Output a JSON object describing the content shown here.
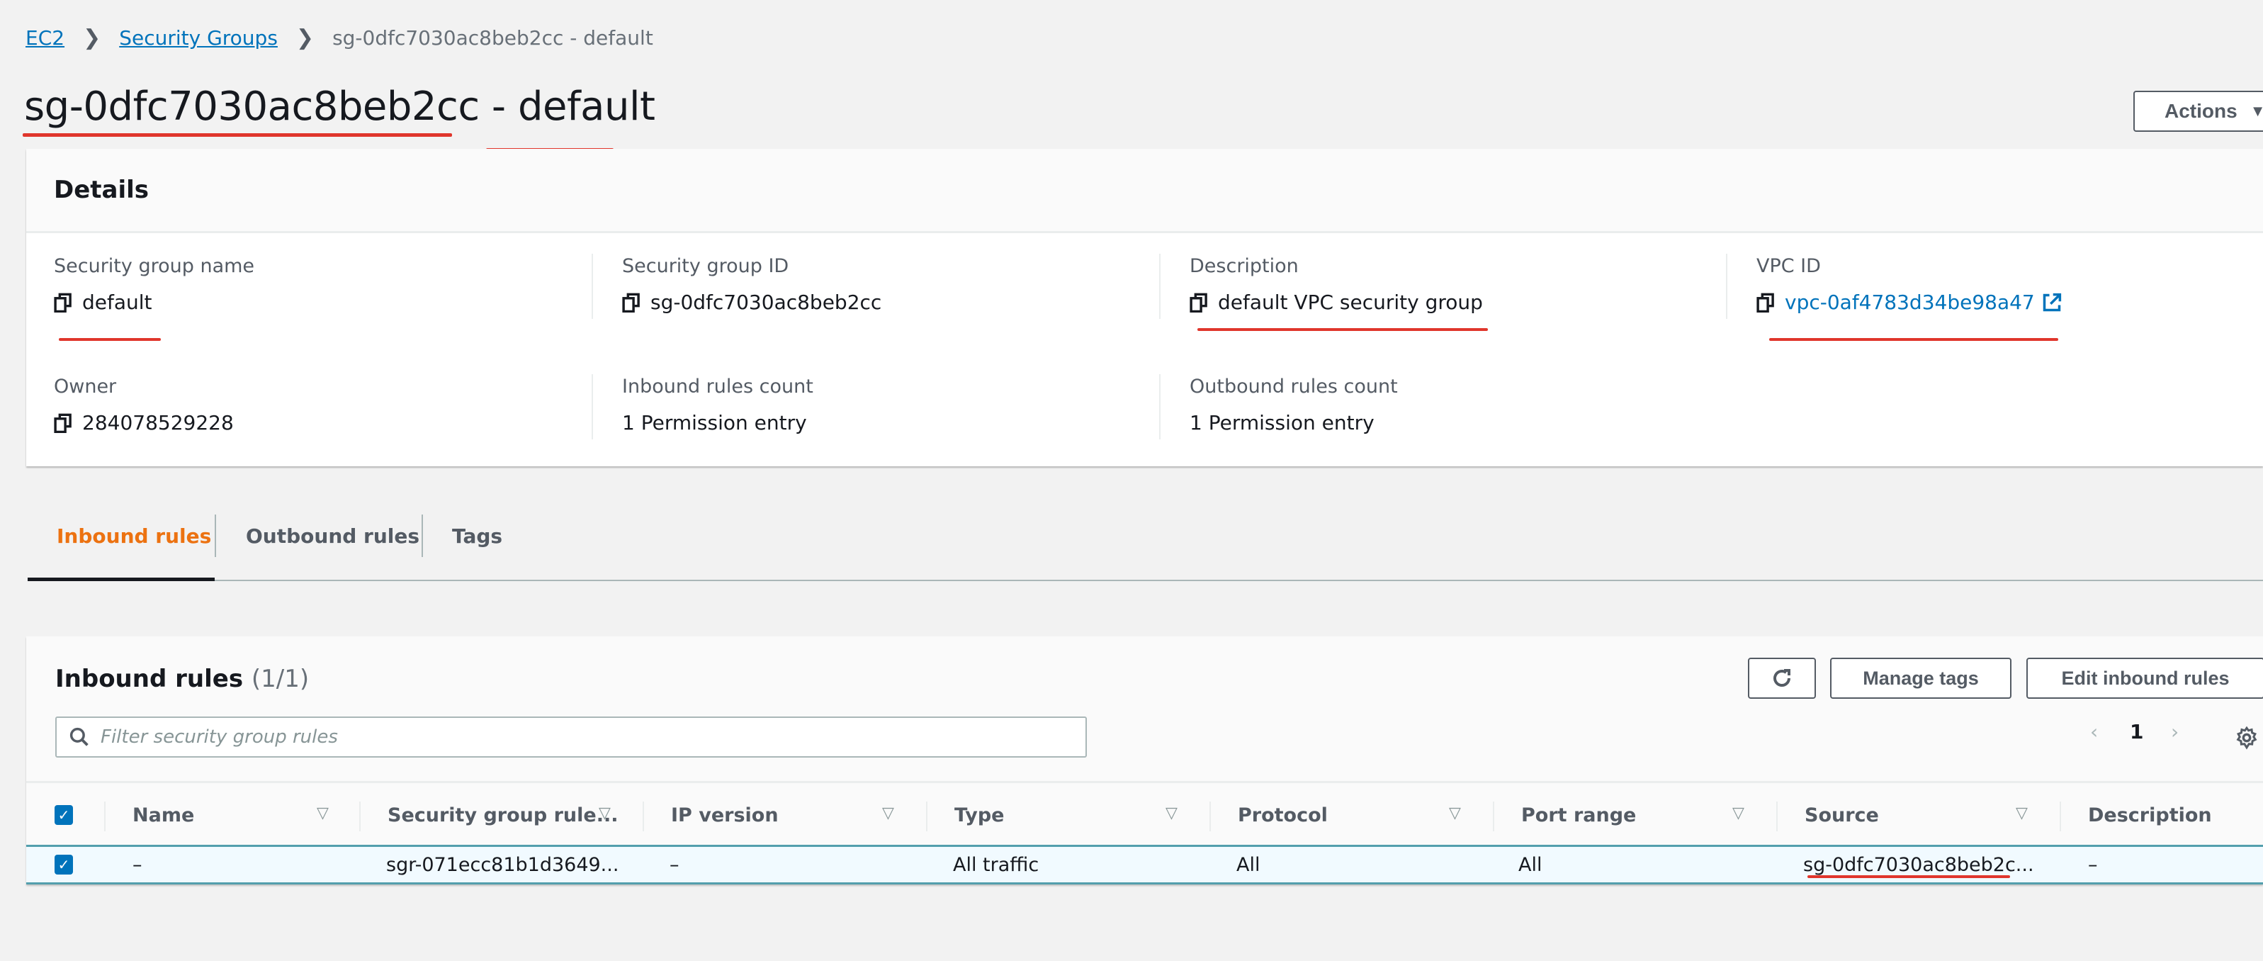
{
  "breadcrumb": {
    "items": [
      {
        "label": "EC2",
        "link": true
      },
      {
        "label": "Security Groups",
        "link": true
      },
      {
        "label": "sg-0dfc7030ac8beb2cc - default",
        "link": false
      }
    ]
  },
  "page": {
    "title_id": "sg-0dfc7030ac8beb2cc",
    "title_sep": " - ",
    "title_name": "default",
    "actions_label": "Actions"
  },
  "details": {
    "heading": "Details",
    "fields": [
      {
        "label": "Security group name",
        "value": "default",
        "copyable": true
      },
      {
        "label": "Security group ID",
        "value": "sg-0dfc7030ac8beb2cc",
        "copyable": true
      },
      {
        "label": "Description",
        "value": "default VPC security group",
        "copyable": true
      },
      {
        "label": "VPC ID",
        "value": "vpc-0af4783d34be98a47",
        "copyable": true,
        "link": true
      },
      {
        "label": "Owner",
        "value": "284078529228",
        "copyable": true
      },
      {
        "label": "Inbound rules count",
        "value": "1 Permission entry"
      },
      {
        "label": "Outbound rules count",
        "value": "1 Permission entry"
      }
    ]
  },
  "tabs": [
    {
      "label": "Inbound rules",
      "active": true
    },
    {
      "label": "Outbound rules",
      "active": false
    },
    {
      "label": "Tags",
      "active": false
    }
  ],
  "inbound": {
    "title": "Inbound rules",
    "count": "(1/1)",
    "search_placeholder": "Filter security group rules",
    "search_value": "",
    "buttons": {
      "refresh": "refresh-icon",
      "manage_tags": "Manage tags",
      "edit": "Edit inbound rules"
    },
    "page": "1",
    "columns": [
      "Name",
      "Security group rule...",
      "IP version",
      "Type",
      "Protocol",
      "Port range",
      "Source",
      "Description"
    ],
    "rows": [
      {
        "selected": true,
        "cells": [
          "–",
          "sgr-071ecc81b1d3649...",
          "–",
          "All traffic",
          "All",
          "All",
          "sg-0dfc7030ac8beb2c...",
          "–"
        ]
      }
    ]
  },
  "colors": {
    "link": "#0073bb",
    "active_tab": "#ec7211",
    "annotation": "#e0362c",
    "selected_row_border": "#539fad"
  }
}
